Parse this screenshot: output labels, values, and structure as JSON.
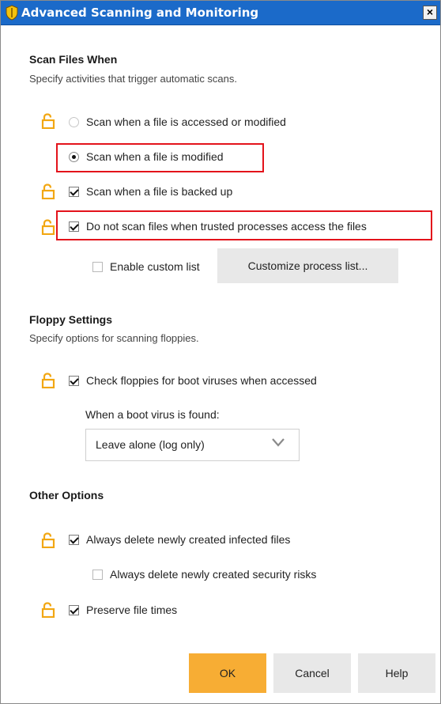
{
  "window": {
    "title": "Advanced Scanning and Monitoring",
    "close_label": "×"
  },
  "colors": {
    "title_bar": "#1b6ac9",
    "lock": "#f2a713",
    "highlight": "#e3131b",
    "ok_button": "#f7ad34"
  },
  "scan_files": {
    "title": "Scan Files When",
    "description": "Specify activities that trigger automatic scans.",
    "options": {
      "accessed_or_modified": {
        "label": "Scan when a file is accessed or modified",
        "selected": false,
        "enabled": false,
        "icon": "lock-icon"
      },
      "modified": {
        "label": "Scan when a file is modified",
        "selected": true,
        "highlighted": true
      },
      "backed_up": {
        "label": "Scan when a file is backed up",
        "checked": true,
        "icon": "lock-icon"
      },
      "trusted_processes": {
        "label": "Do not scan files when trusted processes access the files",
        "checked": true,
        "highlighted": true,
        "icon": "lock-icon"
      },
      "custom_list": {
        "label": "Enable custom list",
        "checked": false
      }
    },
    "customize_button": "Customize process list..."
  },
  "floppy": {
    "title": "Floppy Settings",
    "description": "Specify options for scanning floppies.",
    "check_boot": {
      "label": "Check floppies for boot viruses when accessed",
      "checked": true,
      "icon": "lock-icon"
    },
    "when_found_label": "When a boot virus is found:",
    "action_selected": "Leave alone (log only)"
  },
  "other": {
    "title": "Other Options",
    "delete_infected": {
      "label": "Always delete newly created infected files",
      "checked": true,
      "icon": "lock-icon"
    },
    "delete_risks": {
      "label": "Always delete newly created security risks",
      "checked": false
    },
    "preserve_times": {
      "label": "Preserve file times",
      "checked": true,
      "icon": "lock-icon"
    }
  },
  "buttons": {
    "ok": "OK",
    "cancel": "Cancel",
    "help": "Help"
  }
}
